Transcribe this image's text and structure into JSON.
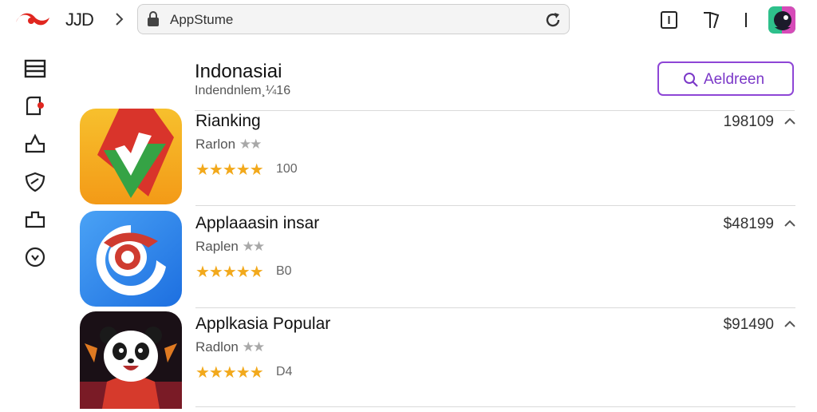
{
  "toolbar": {
    "back_label": "JJD",
    "address": "AppStume"
  },
  "header": {
    "title": "Indonasiai",
    "subtitle": "Indendnlem¸¼16",
    "search_button": "Aeldreen"
  },
  "apps": [
    {
      "name": "Rianking",
      "sub": "Rarlon",
      "sub_stars": "★★",
      "stars": "★★★★★",
      "rating_text": "100",
      "price": "198109",
      "icon": "checkmark-ribbon-icon"
    },
    {
      "name": "Applaaasin insar",
      "sub": "Raplen",
      "sub_stars": "★★",
      "stars": "★★★★★",
      "rating_text": "B0",
      "price": "$48199",
      "icon": "blue-swirl-icon"
    },
    {
      "name": "Applkasia Popular",
      "sub": "Radlon",
      "sub_stars": "★★",
      "stars": "★★★★★",
      "rating_text": "D4",
      "price": "$91490",
      "icon": "panda-game-icon"
    }
  ],
  "colors": {
    "accent": "#8e46d6",
    "star": "#f2a91c",
    "brand_red": "#e0261f"
  }
}
